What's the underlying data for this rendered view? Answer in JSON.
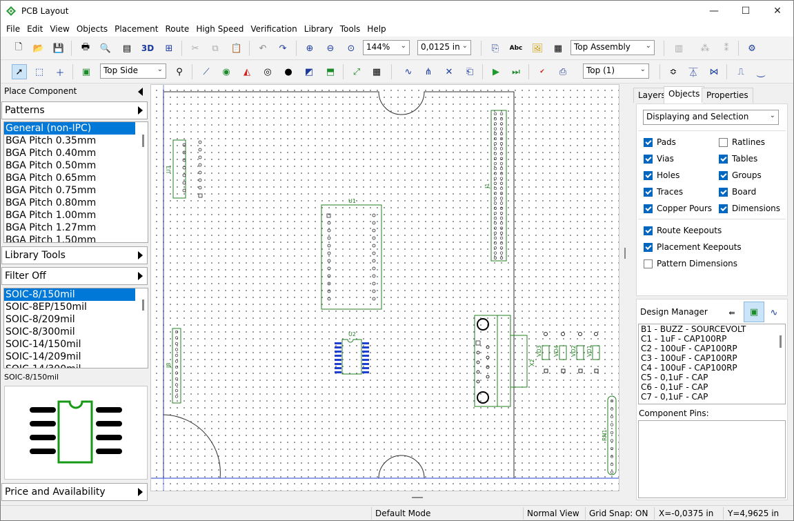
{
  "window": {
    "title": "PCB Layout",
    "minimize": "—",
    "maximize": "☐",
    "close": "✕"
  },
  "menu": [
    "File",
    "Edit",
    "View",
    "Objects",
    "Placement",
    "Route",
    "High Speed",
    "Verification",
    "Library",
    "Tools",
    "Help"
  ],
  "toolbar1": {
    "view3d_label": "3D",
    "zoom_value": "144%",
    "grid_value": "0,0125 in",
    "assembly_value": "Top Assembly",
    "abc_label": "Abc"
  },
  "toolbar2": {
    "side_value": "Top Side",
    "layer_value": "Top (1)"
  },
  "left_panel": {
    "title": "Place Component",
    "patterns_label": "Patterns",
    "pattern_items": [
      "General (non-IPC)",
      "BGA Pitch 0.35mm",
      "BGA Pitch 0.40mm",
      "BGA Pitch 0.50mm",
      "BGA Pitch 0.65mm",
      "BGA Pitch 0.75mm",
      "BGA Pitch 0.80mm",
      "BGA Pitch 1.00mm",
      "BGA Pitch 1.27mm",
      "BGA Pitch 1.50mm"
    ],
    "library_tools_label": "Library Tools",
    "filter_label": "Filter Off",
    "component_items": [
      "SOIC-8/150mil",
      "SOIC-8EP/150mil",
      "SOIC-8/209mil",
      "SOIC-8/300mil",
      "SOIC-14/150mil",
      "SOIC-14/209mil",
      "SOIC-14/300mil"
    ],
    "preview_title": "SOIC-8/150mil",
    "price_label": "Price and Availability"
  },
  "canvas": {
    "designators": {
      "u1": "U1",
      "u2": "U2",
      "u3": "U3",
      "j1": "J1",
      "j8": "J8",
      "x2": "X2",
      "rn1": "RN1",
      "vd1": "VD1",
      "vd2": "VD2",
      "vd3": "VD3",
      "vd4": "VD4"
    }
  },
  "right_panel": {
    "tabs": [
      "Layers",
      "Objects",
      "Properties"
    ],
    "display_select": "Displaying and Selection",
    "checks_left": [
      {
        "label": "Pads",
        "checked": true
      },
      {
        "label": "Vias",
        "checked": true
      },
      {
        "label": "Holes",
        "checked": true
      },
      {
        "label": "Traces",
        "checked": true
      },
      {
        "label": "Copper Pours",
        "checked": true
      }
    ],
    "checks_right": [
      {
        "label": "Ratlines",
        "checked": false
      },
      {
        "label": "Tables",
        "checked": true
      },
      {
        "label": "Groups",
        "checked": true
      },
      {
        "label": "Board",
        "checked": true
      },
      {
        "label": "Dimensions",
        "checked": true
      }
    ],
    "checks_bottom": [
      {
        "label": "Route Keepouts",
        "checked": true
      },
      {
        "label": "Placement Keepouts",
        "checked": true
      },
      {
        "label": "Pattern Dimensions",
        "checked": false
      }
    ],
    "design_manager_title": "Design Manager",
    "dm_items": [
      "B1 - BUZZ - SOURCEVOLT",
      "C1 - 1uF - CAP100RP",
      "C2 - 100uF - CAP100RP",
      "C3 - 100uF - CAP100RP",
      "C4 - 100uF - CAP100RP",
      "C5 - 0,1uF - CAP",
      "C6 - 0,1uF - CAP",
      "C7 - 0,1uF - CAP"
    ],
    "component_pins_label": "Component Pins:"
  },
  "status": {
    "mode": "Default Mode",
    "view": "Normal View",
    "snap": "Grid Snap: ON",
    "x": "X=-0,0375 in",
    "y": "Y=4,9625 in"
  },
  "colors": {
    "accent": "#0078d7",
    "silk": "#208020",
    "board_outline": "#303030",
    "copper_blue": "#1f3fd0"
  }
}
